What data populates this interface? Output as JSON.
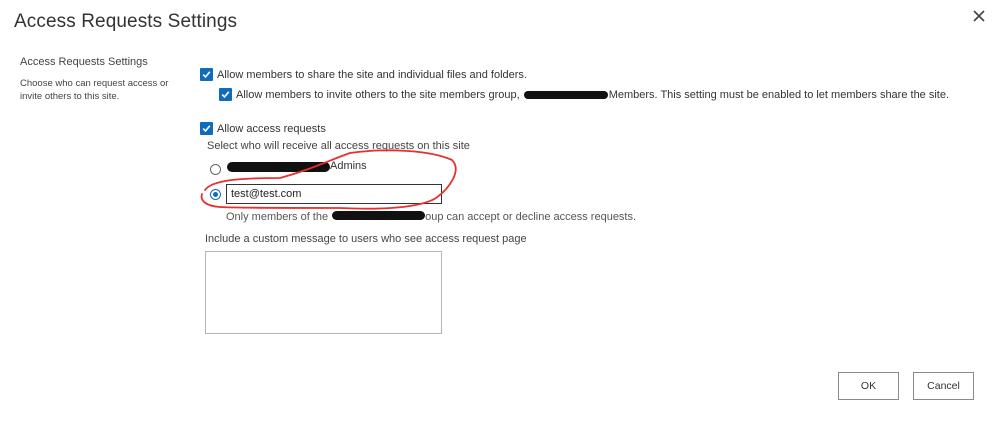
{
  "dialog": {
    "title": "Access Requests Settings",
    "close_label": "✕"
  },
  "section": {
    "title": "Access Requests Settings",
    "description": "Choose who can request access or invite others to this site."
  },
  "sharing": {
    "allow_members_share_label": "Allow members to share the site and individual files and folders.",
    "allow_members_share_checked": true,
    "allow_invite_prefix": "Allow members to invite others to the site members group,",
    "allow_invite_suffix": "Members. This setting must be enabled to let members share the site.",
    "allow_invite_checked": true
  },
  "access_requests": {
    "allow_label": "Allow access requests",
    "allow_checked": true,
    "receivers_label": "Select who will receive all access requests on this site",
    "option_owners_suffix": "Admins",
    "option_owners_selected": false,
    "option_email_selected": true,
    "email_value": "test@test.com",
    "members_note_prefix": "Only members of the",
    "members_note_suffix": "oup can accept or decline access requests."
  },
  "custom_message": {
    "label": "Include a custom message to users who see access request page",
    "value": ""
  },
  "buttons": {
    "ok_label": "OK",
    "cancel_label": "Cancel"
  },
  "colors": {
    "accent": "#0f6cbd",
    "annotation": "#e8302f",
    "redaction": "#111111"
  }
}
